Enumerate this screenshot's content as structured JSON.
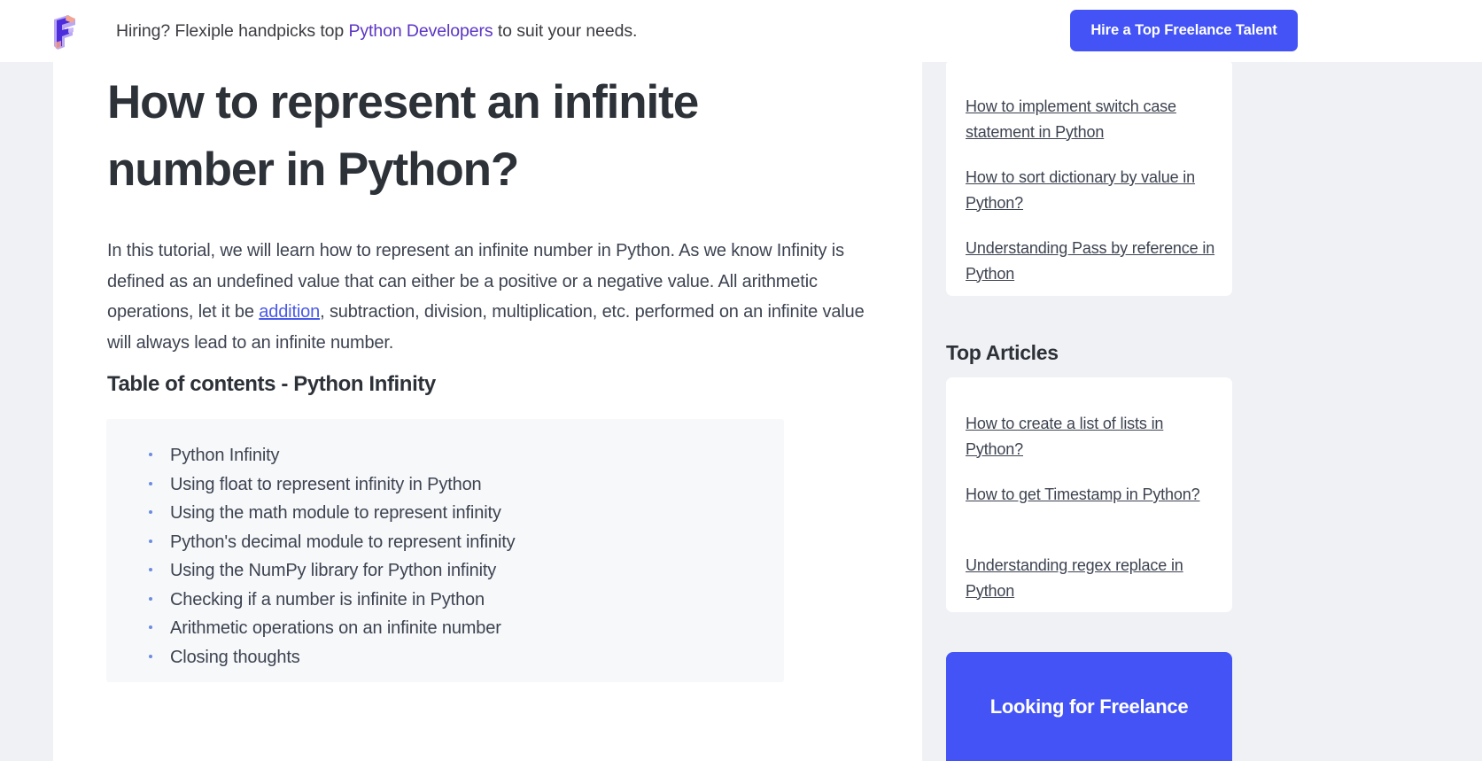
{
  "banner": {
    "logo_alt": "Flexiple logo",
    "text_before": "Hiring? Flexiple handpicks top ",
    "highlight": "Python Developers",
    "text_after": " to suit your needs.",
    "cta_label": "Hire a Top Freelance Talent",
    "cta_color": "#4353f5",
    "highlight_color": "#5b35c4"
  },
  "article": {
    "title": "How to represent an infinite number in Python?",
    "intro_part1": "In this tutorial, we will learn how to represent an infinite number in Python. As we know Infinity is defined as an undefined value that can either be a positive or a negative value. All arithmetic operations, let it be ",
    "intro_link": "addition",
    "intro_part2": ", subtraction, division, multiplication, etc. performed on an infinite value will always lead to an infinite number.",
    "link_color": "#4a5ae8",
    "toc_heading": "Table of contents - Python Infinity",
    "toc_items": [
      "Python Infinity",
      "Using float to represent infinity in Python",
      "Using the math module to represent infinity",
      "Python's decimal module to represent infinity",
      "Using the NumPy library for Python infinity",
      "Checking if a number is infinite in Python",
      "Arithmetic operations on an infinite number",
      "Closing thoughts"
    ],
    "bullet_color": "#6d8ce0"
  },
  "sidebar": {
    "recent_articles": [
      "How to implement switch case statement in Python",
      "How to sort dictionary by value in Python?",
      "Understanding Pass by reference in Python"
    ],
    "top_articles_heading": "Top Articles",
    "top_articles": [
      "How to create a list of lists in Python?",
      "How to get Timestamp in Python?",
      "Understanding regex replace in Python"
    ],
    "promo_title": "Looking for Freelance",
    "promo_color": "#4353f5"
  }
}
